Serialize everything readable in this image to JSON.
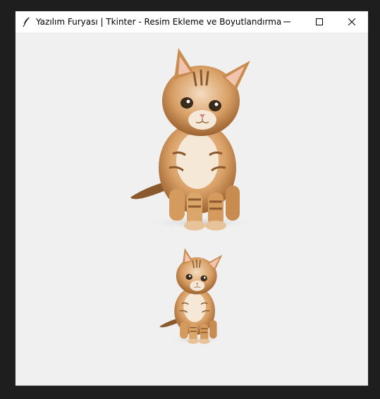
{
  "window": {
    "title": "Yazılım Furyası | Tkinter - Resim Ekleme ve Boyutlandırma",
    "app_icon": "feather-icon",
    "controls": [
      "minimize-icon",
      "maximize-icon",
      "close-icon"
    ]
  },
  "content": {
    "images": [
      {
        "name": "kitten-image-large",
        "subject": "kitten"
      },
      {
        "name": "kitten-image-small",
        "subject": "kitten"
      }
    ]
  },
  "colors": {
    "window_bg": "#f0f0f0",
    "titlebar_bg": "#ffffff",
    "desktop_bg": "#1e1e1e"
  }
}
